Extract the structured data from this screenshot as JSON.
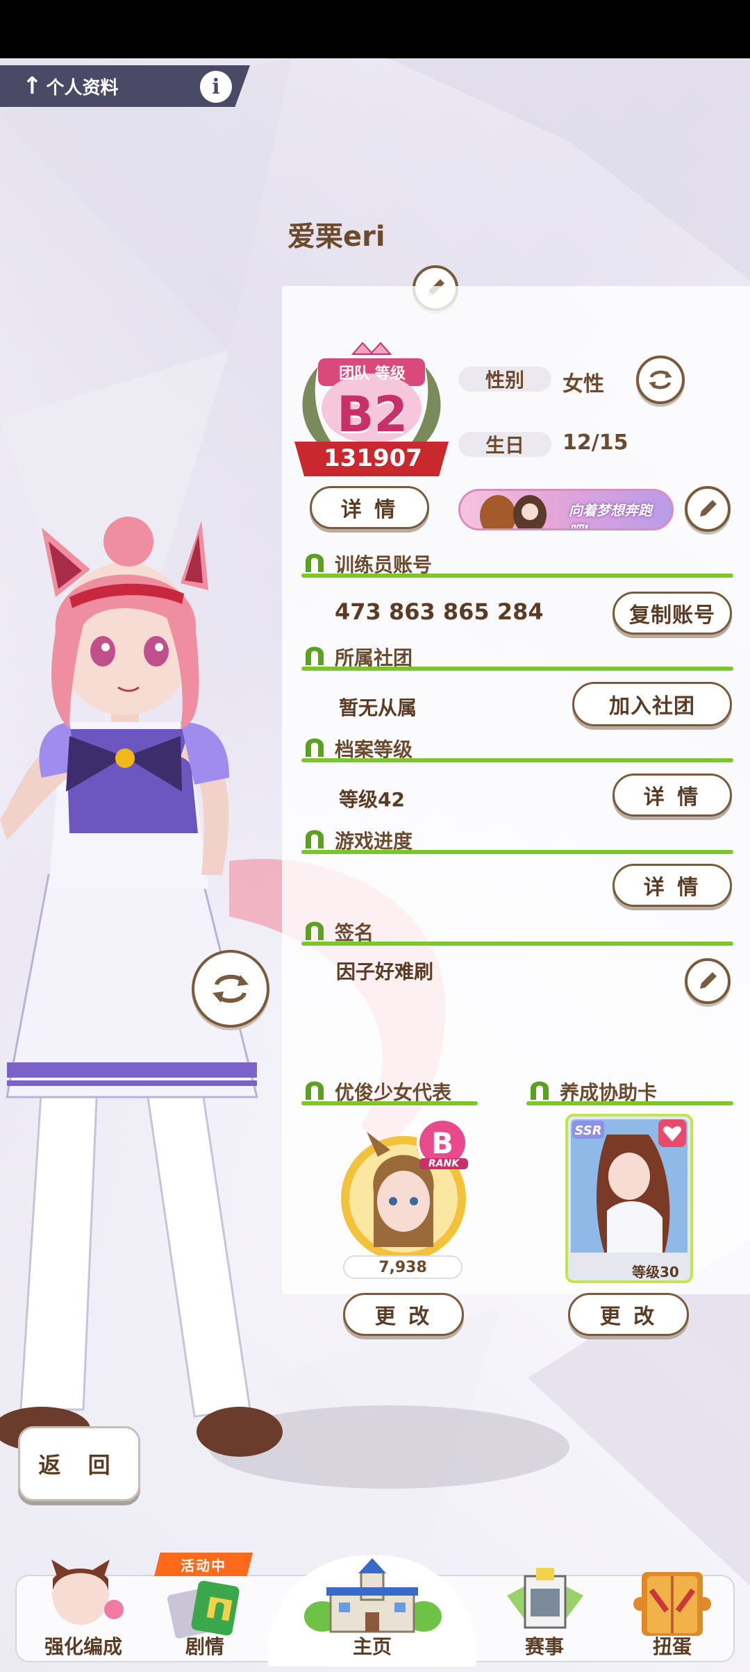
{
  "header": {
    "title": "个人资料",
    "back_symbol": "↑",
    "info_symbol": "i"
  },
  "profile": {
    "name": "爱栗eri",
    "rank": {
      "caption": "团队 等级",
      "grade": "B2",
      "score": "131907"
    },
    "gender_label": "性别",
    "gender_value": "女性",
    "birthday_label": "生日",
    "birthday_value": "12/15",
    "details_button": "详 情",
    "banner_text": "向着梦想奔跑吧!"
  },
  "sections": {
    "trainer_account": {
      "title": "训练员账号",
      "value": "473 863 865 284",
      "button": "复制账号"
    },
    "club": {
      "title": "所属社团",
      "value": "暂无从属",
      "button": "加入社团"
    },
    "profile_level": {
      "title": "档案等级",
      "value": "等级42",
      "button": "详 情"
    },
    "game_progress": {
      "title": "游戏进度",
      "button": "详 情"
    },
    "signature": {
      "title": "签名",
      "value": "因子好难刷"
    },
    "representative": {
      "title": "优俊少女代表",
      "rank_letter": "B",
      "rank_caption": "RANK",
      "fans": "7,938",
      "button": "更 改"
    },
    "support_card": {
      "title": "养成协助卡",
      "rarity": "SSR",
      "level": "等级30",
      "button": "更 改"
    }
  },
  "back_button": "返 回",
  "nav": {
    "items": [
      {
        "label": "强化编成"
      },
      {
        "label": "剧情",
        "tag": "活动中"
      },
      {
        "label": "主页"
      },
      {
        "label": "赛事"
      },
      {
        "label": "扭蛋"
      }
    ]
  },
  "colors": {
    "accent_green": "#7cc62a",
    "text_brown": "#6b4a2d",
    "rank_red": "#c8282e",
    "event_orange": "#ff6a1a"
  }
}
